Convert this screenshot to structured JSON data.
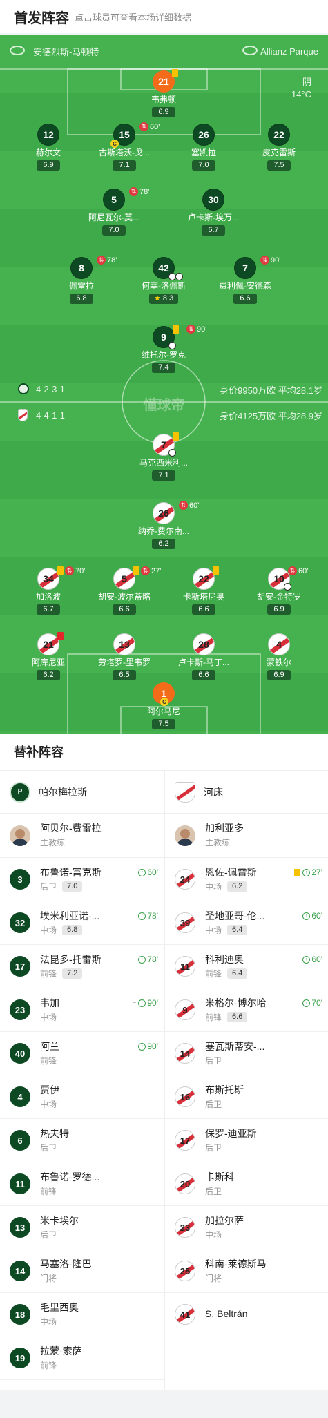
{
  "header": {
    "title": "首发阵容",
    "subtitle": "点击球员可查看本场详细数据"
  },
  "pitch": {
    "home_team": "安德烈斯-马顿特",
    "venue": "Allianz Parque",
    "weather": "阴",
    "temperature": "14°C",
    "home_formation": "4-2-3-1",
    "away_formation": "4-4-1-1",
    "home_value": "身价9950万欧 平均28.1岁",
    "away_value": "身价4125万欧 平均28.9岁",
    "watermark": "懂球帝"
  },
  "home_players": [
    {
      "no": "21",
      "name": "韦弗顿",
      "rating": "6.9"
    },
    {
      "no": "12",
      "name": "赫尔文",
      "rating": "6.9"
    },
    {
      "no": "15",
      "name": "古斯塔沃-戈...",
      "rating": "7.1",
      "sub": "60'"
    },
    {
      "no": "26",
      "name": "塞凯拉",
      "rating": "7.0"
    },
    {
      "no": "22",
      "name": "皮克雷斯",
      "rating": "7.5"
    },
    {
      "no": "5",
      "name": "阿尼瓦尔-莫...",
      "rating": "7.0",
      "sub": "78'"
    },
    {
      "no": "30",
      "name": "卢卡斯-埃万...",
      "rating": "6.7"
    },
    {
      "no": "8",
      "name": "佩雷拉",
      "rating": "6.8",
      "sub": "78'"
    },
    {
      "no": "42",
      "name": "何塞-洛佩斯",
      "rating": "8.3"
    },
    {
      "no": "7",
      "name": "费利佩-安德森",
      "rating": "6.6",
      "sub": "90'"
    },
    {
      "no": "9",
      "name": "维托尔-罗克",
      "rating": "7.4",
      "sub": "90'"
    }
  ],
  "away_players": [
    {
      "no": "7",
      "name": "马克西米利...",
      "rating": "7.1"
    },
    {
      "no": "26",
      "name": "纳乔-费尔南...",
      "rating": "6.2",
      "sub": "60'"
    },
    {
      "no": "34",
      "name": "加洛波",
      "rating": "6.7",
      "sub": "70'"
    },
    {
      "no": "5",
      "name": "胡安-波尔蒂略",
      "rating": "6.6",
      "sub": "27'"
    },
    {
      "no": "22",
      "name": "卡斯塔尼奥",
      "rating": "6.6"
    },
    {
      "no": "10",
      "name": "胡安-金特罗",
      "rating": "6.9",
      "sub": "60'"
    },
    {
      "no": "21",
      "name": "阿库尼亚",
      "rating": "6.2"
    },
    {
      "no": "13",
      "name": "劳塔罗-里韦罗",
      "rating": "6.5"
    },
    {
      "no": "28",
      "name": "卢卡斯-马丁...",
      "rating": "6.6"
    },
    {
      "no": "4",
      "name": "蒙铁尔",
      "rating": "6.9"
    },
    {
      "no": "1",
      "name": "阿尔马尼",
      "rating": "7.5"
    }
  ],
  "subs": {
    "title": "替补阵容",
    "home": {
      "team": "帕尔梅拉斯",
      "coach": "阿贝尔-费雷拉",
      "coach_role": "主教练",
      "players": [
        {
          "no": "3",
          "name": "布鲁诺-富克斯",
          "pos": "后卫",
          "rating": "7.0",
          "ev": "60'"
        },
        {
          "no": "32",
          "name": "埃米利亚诺-...",
          "pos": "中场",
          "rating": "6.8",
          "ev": "78'"
        },
        {
          "no": "17",
          "name": "法昆多-托雷斯",
          "pos": "前锋",
          "rating": "7.2",
          "ev": "78'"
        },
        {
          "no": "23",
          "name": "韦加",
          "pos": "中场",
          "rating": "",
          "ev": "90'"
        },
        {
          "no": "40",
          "name": "阿兰",
          "pos": "前锋",
          "rating": "",
          "ev": "90'"
        },
        {
          "no": "4",
          "name": "贾伊",
          "pos": "中场",
          "rating": "",
          "ev": ""
        },
        {
          "no": "6",
          "name": "热夫特",
          "pos": "后卫",
          "rating": "",
          "ev": ""
        },
        {
          "no": "11",
          "name": "布鲁诺-罗德...",
          "pos": "前锋",
          "rating": "",
          "ev": ""
        },
        {
          "no": "13",
          "name": "米卡埃尔",
          "pos": "后卫",
          "rating": "",
          "ev": ""
        },
        {
          "no": "14",
          "name": "马塞洛-隆巴",
          "pos": "门将",
          "rating": "",
          "ev": ""
        },
        {
          "no": "18",
          "name": "毛里西奥",
          "pos": "中场",
          "rating": "",
          "ev": ""
        },
        {
          "no": "19",
          "name": "拉蒙-索萨",
          "pos": "前锋",
          "rating": "",
          "ev": ""
        }
      ]
    },
    "away": {
      "team": "河床",
      "coach": "加利亚多",
      "coach_role": "主教练",
      "players": [
        {
          "no": "24",
          "name": "恩佐-佩雷斯",
          "pos": "中场",
          "rating": "6.2",
          "ev": "27'"
        },
        {
          "no": "39",
          "name": "圣地亚哥-伦...",
          "pos": "中场",
          "rating": "6.4",
          "ev": "60'"
        },
        {
          "no": "11",
          "name": "科利迪奥",
          "pos": "前锋",
          "rating": "6.4",
          "ev": "60'"
        },
        {
          "no": "9",
          "name": "米格尔-博尔哈",
          "pos": "前锋",
          "rating": "6.6",
          "ev": "70'"
        },
        {
          "no": "14",
          "name": "塞瓦斯蒂安-...",
          "pos": "后卫",
          "rating": "",
          "ev": ""
        },
        {
          "no": "16",
          "name": "布斯托斯",
          "pos": "后卫",
          "rating": "",
          "ev": ""
        },
        {
          "no": "17",
          "name": "保罗-迪亚斯",
          "pos": "后卫",
          "rating": "",
          "ev": ""
        },
        {
          "no": "20",
          "name": "卡斯科",
          "pos": "后卫",
          "rating": "",
          "ev": ""
        },
        {
          "no": "23",
          "name": "加拉尔萨",
          "pos": "中场",
          "rating": "",
          "ev": ""
        },
        {
          "no": "25",
          "name": "科南-莱德斯马",
          "pos": "门将",
          "rating": "",
          "ev": ""
        },
        {
          "no": "41",
          "name": "S. Beltrán",
          "pos": "",
          "rating": "",
          "ev": ""
        }
      ]
    }
  },
  "colors": {
    "pitch": "#45b24f",
    "home": "#0d4a23",
    "away_red": "#d8303a",
    "gk": "#f46b1a"
  }
}
